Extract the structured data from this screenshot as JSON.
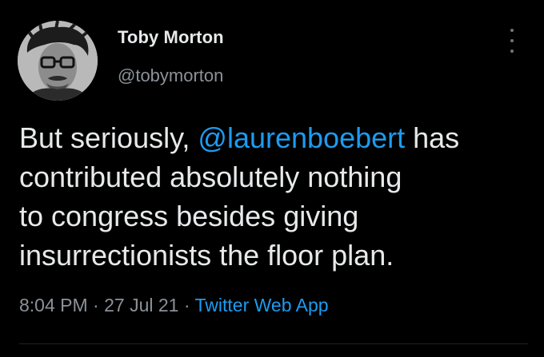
{
  "tweet": {
    "author": {
      "display_name": "Toby Morton",
      "handle": "@tobymorton",
      "avatar_icon": "profile-photo"
    },
    "more_icon": "more-vertical-icon",
    "text": {
      "line1_before": "But seriously, ",
      "mention": "@laurenboebert",
      "line1_after": " has",
      "line2": "contributed absolutely nothing",
      "line3": "to congress besides giving",
      "line4": "insurrectionists the floor plan."
    },
    "meta": {
      "time": "8:04 PM",
      "separator1": " · ",
      "date": "27 Jul 21",
      "separator2": " · ",
      "source": "Twitter Web App"
    }
  },
  "colors": {
    "background": "#000000",
    "text_primary": "#e7e9ea",
    "text_secondary": "#8b9298",
    "link": "#1d9bf0"
  }
}
